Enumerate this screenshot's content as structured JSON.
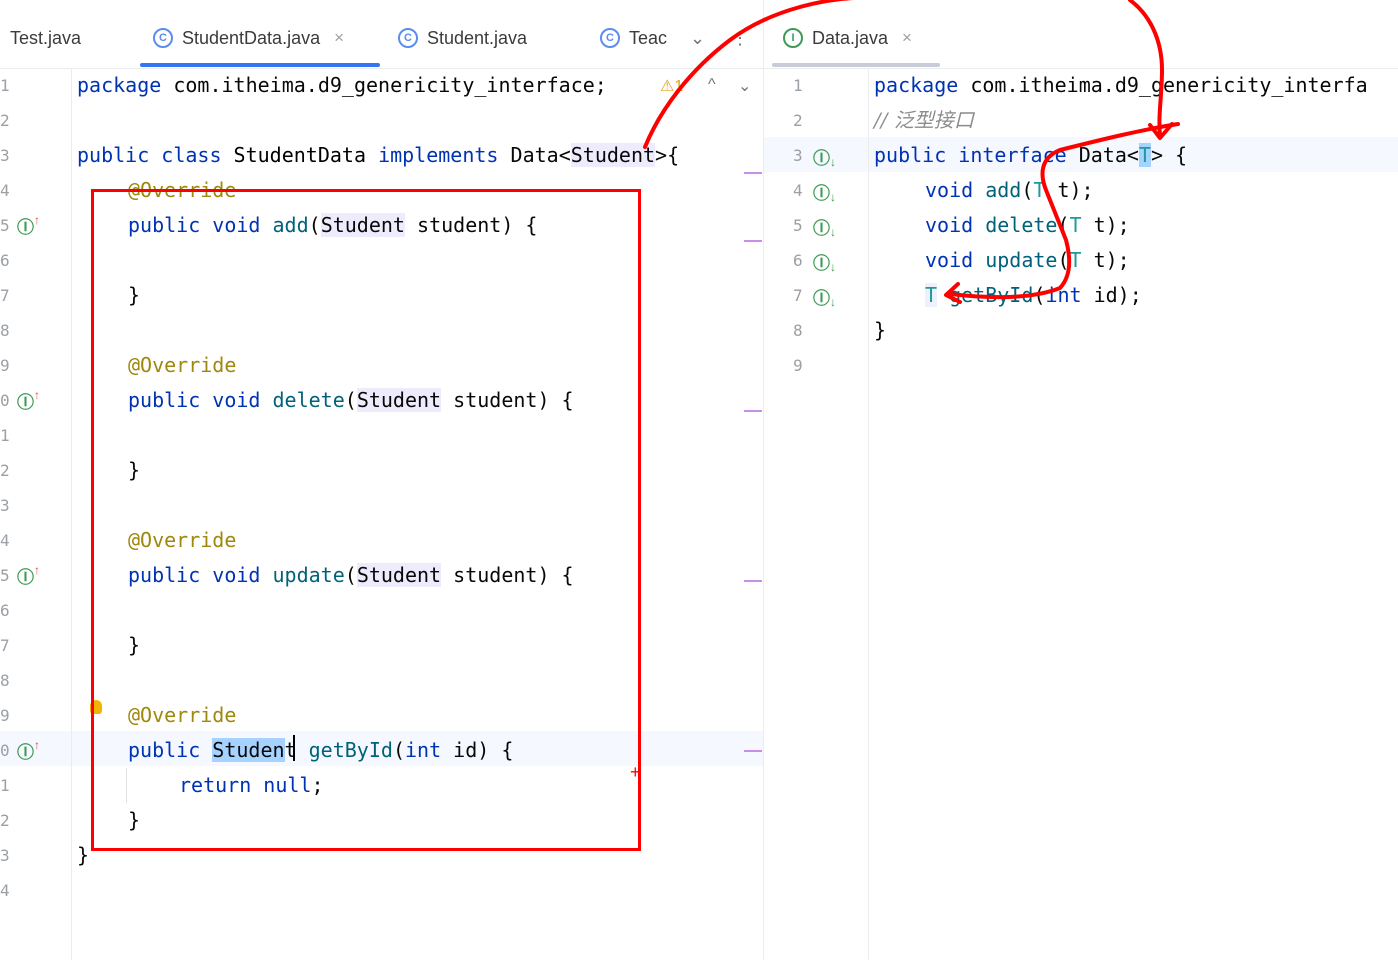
{
  "left_tabs": [
    {
      "label": "Test.java",
      "icon": "java-class-icon"
    },
    {
      "label": "StudentData.java",
      "icon": "java-class-icon",
      "active": true,
      "close": "×"
    },
    {
      "label": "Student.java",
      "icon": "java-class-icon"
    },
    {
      "label": "Teac",
      "icon": "java-class-icon"
    }
  ],
  "left_tab_icon_glyph": "C",
  "tab_dropdown": "⌄",
  "tab_menu": "⋮",
  "right_tabs": [
    {
      "label": "Data.java",
      "icon": "java-interface-icon",
      "active": true,
      "close": "×"
    }
  ],
  "right_tab_icon_glyph": "I",
  "warnings": {
    "glyph": "⚠",
    "count": "1",
    "prev": "^",
    "next": "⌄"
  },
  "left_editor": {
    "line_numbers": [
      "1",
      "2",
      "3",
      "4",
      "5",
      "6",
      "7",
      "8",
      "9",
      "0",
      "1",
      "2",
      "3",
      "4",
      "5",
      "6",
      "7",
      "8",
      "9",
      "0",
      "1",
      "2",
      "3",
      "4"
    ],
    "lines": {
      "l1": [
        "package",
        " com.itheima.d9_genericity_interface;"
      ],
      "l3": [
        "public",
        " ",
        "class",
        " StudentData ",
        "implements",
        " Data<",
        "Student",
        ">{"
      ],
      "l4": "@Override",
      "l5": [
        "public",
        " ",
        "void",
        " ",
        "add",
        "(",
        "Student",
        " student) {"
      ],
      "l7": "}",
      "l9": "@Override",
      "l10": [
        "public",
        " ",
        "void",
        " ",
        "delete",
        "(",
        "Student",
        " student) {"
      ],
      "l12": "}",
      "l14": "@Override",
      "l15": [
        "public",
        " ",
        "void",
        " ",
        "update",
        "(",
        "Student",
        " student) {"
      ],
      "l17": "}",
      "l19": "@Override",
      "l20": [
        "public",
        " ",
        "Studen",
        "t",
        " ",
        "getById",
        "(",
        "int",
        " id) {"
      ],
      "l21": [
        "return",
        " ",
        "null",
        ";"
      ],
      "l22": "}",
      "l23": "}"
    }
  },
  "right_editor": {
    "line_numbers": [
      "1",
      "2",
      "3",
      "4",
      "5",
      "6",
      "7",
      "8",
      "9"
    ],
    "lines": {
      "l1": [
        "package",
        " com.itheima.d9_genericity_interfa"
      ],
      "l2": "// 泛型接口",
      "l3": [
        "public",
        " ",
        "interface",
        " Data<",
        "T",
        "> {"
      ],
      "l4": [
        "void",
        " ",
        "add",
        "(",
        "T",
        " t);"
      ],
      "l5": [
        "void",
        " ",
        "delete",
        "(",
        "T",
        " t);"
      ],
      "l6": [
        "void",
        " ",
        "update",
        "(",
        "T",
        " t);"
      ],
      "l7": [
        "T",
        " ",
        "getById",
        "(",
        "int",
        " id);"
      ],
      "l8": "}"
    }
  },
  "gutter_icon_glyph": "Ⓘ",
  "gutter_up_arrow": "↑",
  "gutter_down_arrow": "↓",
  "plus_marker": "+",
  "colors": {
    "keyword": "#0033b3",
    "annotation": "#9e880d",
    "method": "#00627a",
    "accent": "#3574f0",
    "annotation_red": "#ff0000"
  }
}
